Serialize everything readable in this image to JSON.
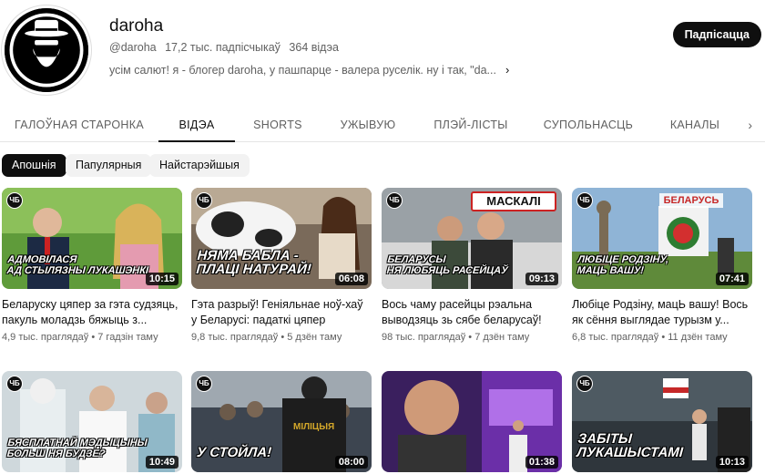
{
  "channel": {
    "name": "daroha",
    "handle": "@daroha",
    "subscribers": "17,2 тыс. падпісчыкаў",
    "video_count": "364 відэа",
    "description": "усім салют! я - блогер daroha, у пашпарце - валера руселік. ну і так, \"da...",
    "subscribe_label": "Падпісацца"
  },
  "tabs": [
    {
      "label": "ГАЛОЎНАЯ СТАРОНКА",
      "active": false
    },
    {
      "label": "ВІДЭА",
      "active": true
    },
    {
      "label": "SHORTS",
      "active": false
    },
    {
      "label": "УЖЫВУЮ",
      "active": false
    },
    {
      "label": "ПЛЭЙ-ЛІСТЫ",
      "active": false
    },
    {
      "label": "СУПОЛЬНАСЦЬ",
      "active": false
    },
    {
      "label": "КАНАЛЫ",
      "active": false
    }
  ],
  "chips": [
    {
      "label": "Апошнія",
      "active": true
    },
    {
      "label": "Папулярныя",
      "active": false
    },
    {
      "label": "Найстарэйшыя",
      "active": false
    }
  ],
  "badge_text": "ЧБ",
  "videos": [
    {
      "overlay": "АДМОВІЛАСЯ\nАД СТЫЛЯЗНЫ ЛУКАШЭНКІ",
      "duration": "10:15",
      "title": "Беларуску цяпер за гэта судзяць, пакуль моладзь бяжыць з...",
      "views": "4,9 тыс. праглядаў",
      "age": "7 гадзін таму"
    },
    {
      "overlay": "НЯМА БАБЛА -\nПЛАЦІ НАТУРАЙ!",
      "duration": "06:08",
      "title": "Гэта разрыў! Геніяльнае ноў-хаў у Беларусі: падаткі цяпер можна...",
      "views": "9,8 тыс. праглядаў",
      "age": "5 дзён таму"
    },
    {
      "overlay": "БЕЛАРУСЫ\nНЯ ЛЮБЯЦЬ РАСЕЙЦАЎ",
      "duration": "09:13",
      "title": "Вось чаму расейцы рэальна выводзяць зь сябе беларусаў!",
      "views": "98 тыс. праглядаў",
      "age": "7 дзён таму",
      "sign": "МАСКАЛІ"
    },
    {
      "overlay": "ЛЮБІЦЕ РОДЗІНУ,\nМАЦЬ ВАШУ!",
      "duration": "07:41",
      "title": "Любіце Родзіну, мацЬ вашу! Вось як сёння выглядае турызм у...",
      "views": "6,8 тыс. праглядаў",
      "age": "11 дзён таму",
      "sign": "БЕЛАРУСЬ"
    },
    {
      "overlay": "БЯСПЛАТНАЙ МЭДЫЦЫНЫ\nБОЛЬШ НЯ БУДЗЕ?",
      "duration": "10:49",
      "title": "",
      "views": "",
      "age": ""
    },
    {
      "overlay": "У СТОЙЛА!",
      "duration": "08:00",
      "title": "",
      "views": "",
      "age": "",
      "sign": "МІЛІЦЫЯ"
    },
    {
      "overlay": "",
      "duration": "01:38",
      "title": "",
      "views": "",
      "age": ""
    },
    {
      "overlay": "ЗАБІТЫ\nЛУКАШЫСТАМІ",
      "duration": "10:13",
      "title": "",
      "views": "",
      "age": ""
    }
  ],
  "colors": {
    "accent": "#0f0f0f",
    "muted": "#606060",
    "chip_bg": "#f2f2f2"
  }
}
